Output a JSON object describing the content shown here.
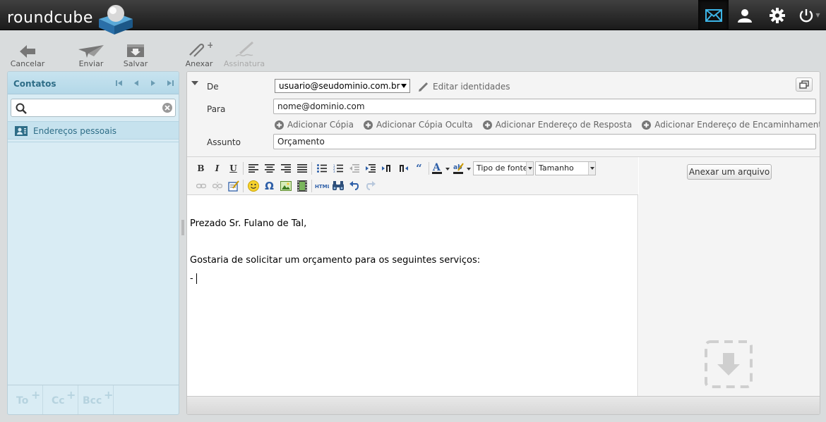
{
  "app": {
    "logo_text": "roundcube"
  },
  "topnav": [
    {
      "name": "mail-icon",
      "active": true
    },
    {
      "name": "contacts-icon"
    },
    {
      "name": "settings-icon"
    },
    {
      "name": "logout-icon"
    }
  ],
  "toolbar": {
    "cancel": "Cancelar",
    "send": "Enviar",
    "save": "Salvar",
    "attach": "Anexar",
    "signature": "Assinatura"
  },
  "contacts": {
    "title": "Contatos",
    "search_value": "",
    "address_book": "Endereços pessoais",
    "recipient_buttons": [
      "To",
      "Cc",
      "Bcc"
    ]
  },
  "compose": {
    "from_label": "De",
    "from_value": "usuario@seudominio.com.br",
    "edit_identities": "Editar identidades",
    "to_label": "Para",
    "to_value": "nome@dominio.com",
    "add_links": [
      "Adicionar Cópia",
      "Adicionar Cópia Oculta",
      "Adicionar Endereço de Resposta",
      "Adicionar Endereço de Encaminhamento"
    ],
    "subject_label": "Assunto",
    "subject_value": "Orçamento",
    "font_family": "Tipo de fonte",
    "font_size": "Tamanho",
    "body": [
      "Prezado Sr. Fulano de Tal,",
      "",
      "Gostaria de solicitar um orçamento para os seguintes serviços:",
      "- "
    ],
    "attach_button": "Anexar um arquivo"
  },
  "colors": {
    "topbar": "#262626",
    "panel_blue": "#d9ecf4",
    "accent_blue": "#2e6d87",
    "mail_icon": "#3cb4e6"
  }
}
